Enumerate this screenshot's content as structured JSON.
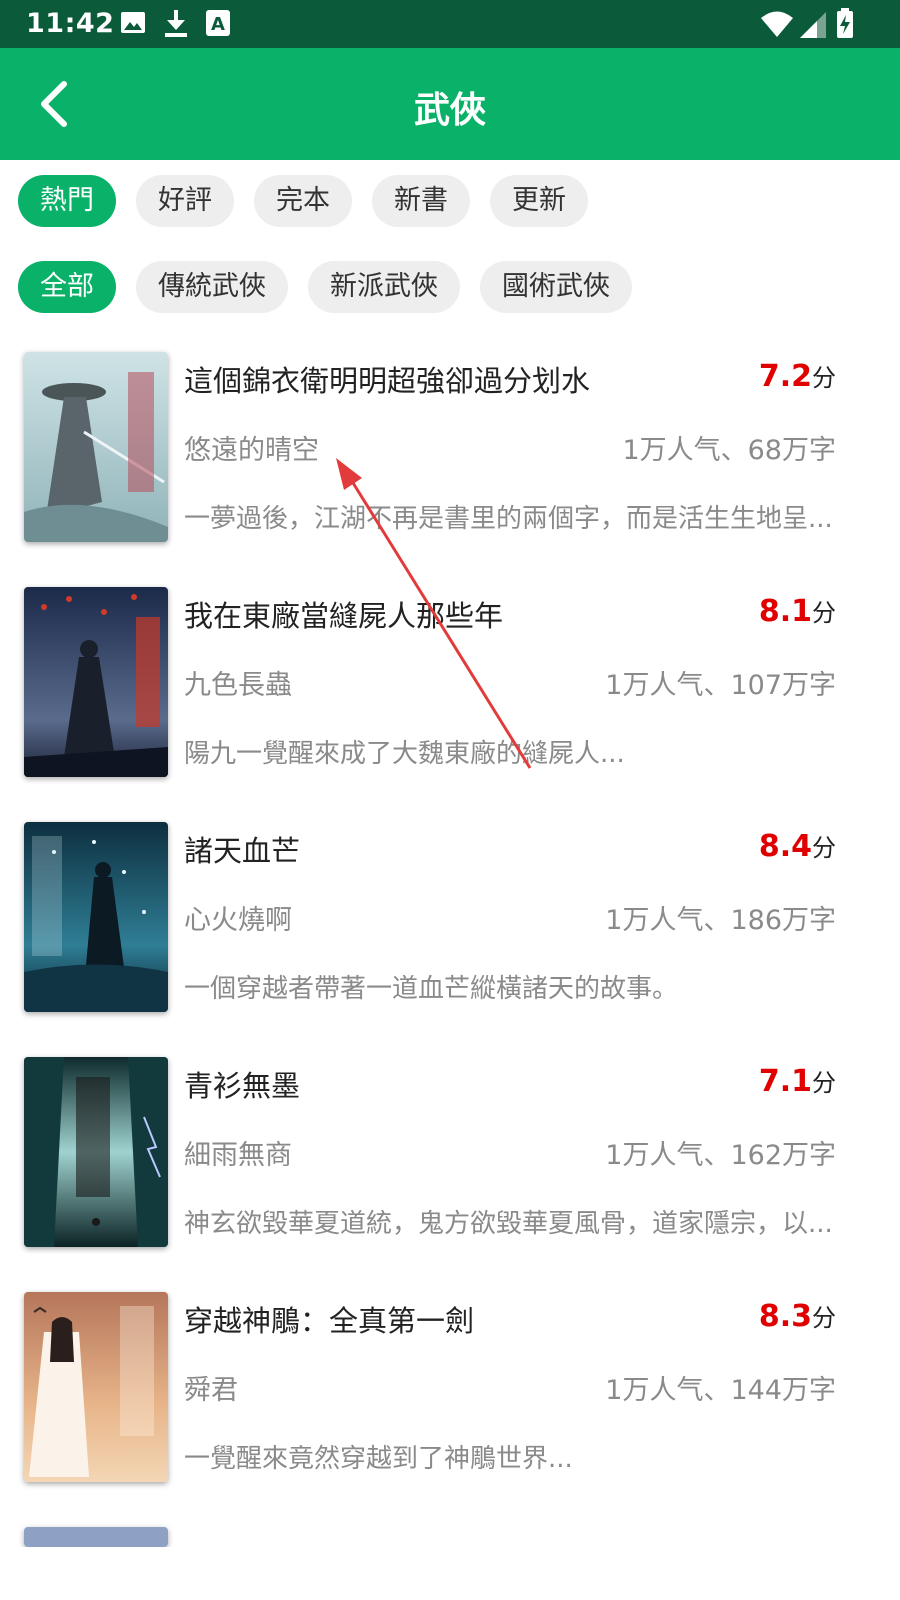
{
  "status_bar": {
    "time": "11:42",
    "icons": [
      "image-icon",
      "download-icon",
      "text-a-icon",
      "wifi-icon",
      "signal-icon",
      "battery-icon"
    ]
  },
  "app_bar": {
    "title": "武俠",
    "back_icon": "chevron-left-icon"
  },
  "sort_tabs": [
    "熱門",
    "好評",
    "完本",
    "新書",
    "更新"
  ],
  "category_tabs": [
    "全部",
    "傳統武俠",
    "新派武俠",
    "國術武俠"
  ],
  "colors": {
    "primary": "#09b169",
    "status_bar": "#0b5a3a",
    "score": "#e00000",
    "muted_text": "#8a8a8a",
    "annotation_arrow": "#e23b3b"
  },
  "books": [
    {
      "title": "這個錦衣衛明明超強卻過分划水",
      "score": "7.2",
      "score_unit": "分",
      "author": "悠遠的晴空",
      "stats": "1万人气、68万字",
      "desc": "一夢過後，江湖不再是書里的兩個字，而是活生生地呈..."
    },
    {
      "title": "我在東廠當縫屍人那些年",
      "score": "8.1",
      "score_unit": "分",
      "author": "九色長蟲",
      "stats": "1万人气、107万字",
      "desc": "陽九一覺醒來成了大魏東廠的縫屍人..."
    },
    {
      "title": "諸天血芒",
      "score": "8.4",
      "score_unit": "分",
      "author": "心火燒啊",
      "stats": "1万人气、186万字",
      "desc": "一個穿越者帶著一道血芒縱橫諸天的故事。"
    },
    {
      "title": "青衫無墨",
      "score": "7.1",
      "score_unit": "分",
      "author": "細雨無商",
      "stats": "1万人气、162万字",
      "desc": "神玄欲毀華夏道統，鬼方欲毀華夏風骨，道家隱宗，以..."
    },
    {
      "title": "穿越神鵰：全真第一劍",
      "score": "8.3",
      "score_unit": "分",
      "author": "舜君",
      "stats": "1万人气、144万字",
      "desc": "一覺醒來竟然穿越到了神鵰世界..."
    }
  ]
}
